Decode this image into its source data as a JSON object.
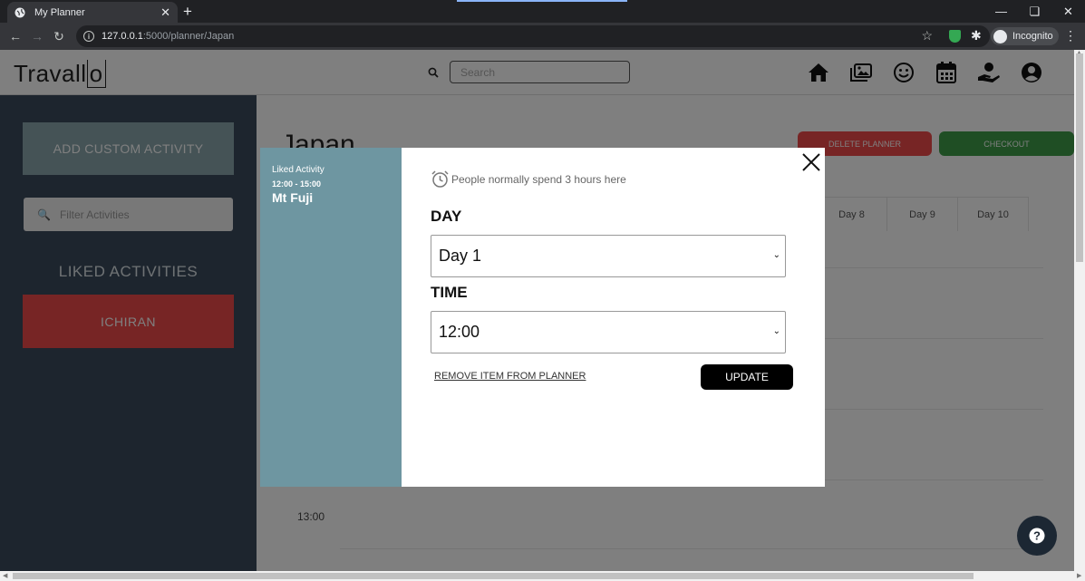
{
  "browser": {
    "tab_title": "My Planner",
    "tab_close": "✕",
    "new_tab": "+",
    "url_host": "127.0.0.1",
    "url_path": ":5000/planner/Japan",
    "incognito_label": "Incognito"
  },
  "header": {
    "logo_text_a": "Travall",
    "logo_text_b": "o",
    "search_placeholder": "Search",
    "nav_icons": [
      "home-icon",
      "gallery-icon",
      "smile-icon",
      "calendar-icon",
      "donate-icon",
      "account-icon"
    ]
  },
  "sidebar": {
    "add_custom_label": "ADD CUSTOM ACTIVITY",
    "filter_placeholder": "Filter Activities",
    "liked_heading": "LIKED ACTIVITIES",
    "liked_items": [
      "ICHIRAN"
    ]
  },
  "main": {
    "title": "Japan",
    "delete_label": "DELETE PLANNER",
    "checkout_label": "CHECKOUT",
    "day_tabs": [
      "Day 8",
      "Day 9",
      "Day 10"
    ],
    "time_label": "13:00"
  },
  "modal": {
    "activity_kind": "Liked Activity",
    "activity_time": "12:00 - 15:00",
    "activity_name": "Mt Fuji",
    "hint": "People normally spend 3 hours here",
    "day_label": "DAY",
    "day_value": "Day 1",
    "time_label": "TIME",
    "time_value": "12:00",
    "remove_label": "REMOVE ITEM FROM PLANNER",
    "update_label": "UPDATE"
  },
  "colors": {
    "sidebar_bg": "#3b4a5c",
    "activity_panel": "#6e96a1",
    "danger": "#ef4b4b",
    "success": "#3f9c49"
  }
}
